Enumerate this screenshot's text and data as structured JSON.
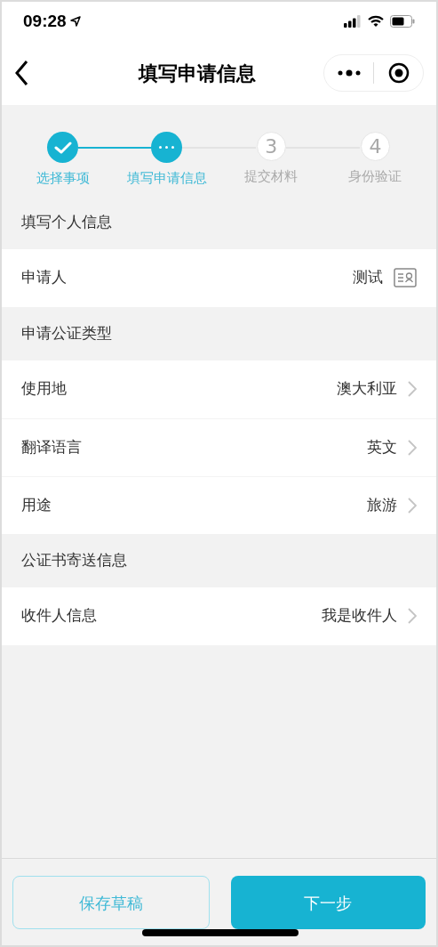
{
  "status_bar": {
    "time": "09:28"
  },
  "nav": {
    "title": "填写申请信息"
  },
  "steps": [
    {
      "label": "选择事项",
      "kind": "done"
    },
    {
      "label": "填写申请信息",
      "kind": "current"
    },
    {
      "label": "提交材料",
      "kind": "todo",
      "number": "3"
    },
    {
      "label": "身份验证",
      "kind": "todo",
      "number": "4"
    }
  ],
  "sections": [
    {
      "title": "填写个人信息",
      "rows": [
        {
          "label": "申请人",
          "value": "测试",
          "kind": "card"
        }
      ]
    },
    {
      "title": "申请公证类型",
      "rows": [
        {
          "label": "使用地",
          "value": "澳大利亚",
          "kind": "link"
        },
        {
          "label": "翻译语言",
          "value": "英文",
          "kind": "link"
        },
        {
          "label": "用途",
          "value": "旅游",
          "kind": "link"
        }
      ]
    },
    {
      "title": "公证书寄送信息",
      "rows": [
        {
          "label": "收件人信息",
          "value": "我是收件人",
          "kind": "link"
        }
      ]
    }
  ],
  "buttons": {
    "secondary": "保存草稿",
    "primary": "下一步"
  }
}
